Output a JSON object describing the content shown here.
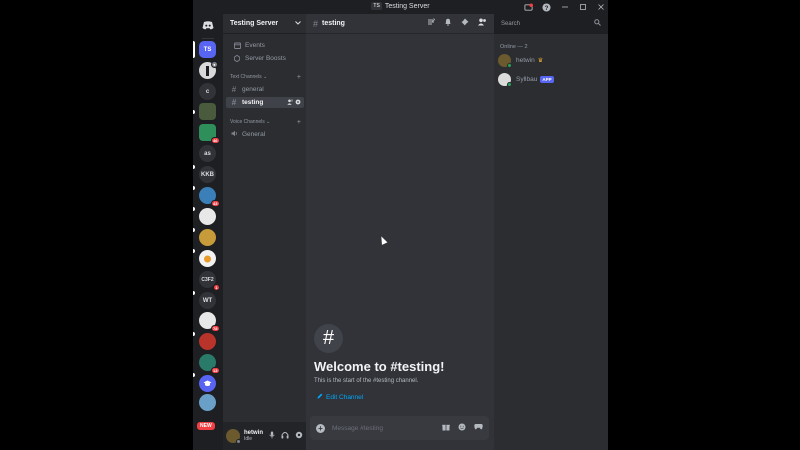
{
  "window": {
    "badge": "TS",
    "title": "Testing Server",
    "icons": [
      "inbox-icon",
      "help-icon",
      "minimize-icon",
      "maximize-icon",
      "close-icon"
    ]
  },
  "guild_list": {
    "items": [
      {
        "label": "TS",
        "selected": true
      },
      {
        "label": "",
        "badge": ""
      },
      {
        "label": "c"
      },
      {
        "label": ""
      },
      {
        "label": "",
        "badge": "46"
      },
      {
        "label": "as"
      },
      {
        "label": "KKB"
      },
      {
        "label": "",
        "badge": "43"
      },
      {
        "label": ""
      },
      {
        "label": ""
      },
      {
        "label": ""
      },
      {
        "label": "C3F2",
        "badge": "1"
      },
      {
        "label": "WT"
      },
      {
        "label": "",
        "badge": "78"
      },
      {
        "label": ""
      },
      {
        "label": "",
        "badge": "13"
      },
      {
        "label": ""
      },
      {
        "label": ""
      }
    ],
    "new_badge": "NEW"
  },
  "sidebar": {
    "server_name": "Testing Server",
    "top_items": [
      {
        "label": "Events",
        "icon": "calendar-icon"
      },
      {
        "label": "Server Boosts",
        "icon": "boost-icon"
      }
    ],
    "text_category": "Text Channels",
    "text_channels": [
      {
        "name": "general",
        "active": false
      },
      {
        "name": "testing",
        "active": true
      }
    ],
    "voice_category": "Voice Channels",
    "voice_channels": [
      {
        "name": "General"
      }
    ]
  },
  "user": {
    "name": "hetwin",
    "status": "Idle"
  },
  "channel": {
    "name": "testing",
    "welcome_title": "Welcome to #testing!",
    "welcome_sub": "This is the start of the #testing channel.",
    "edit_label": "Edit Channel",
    "message_placeholder": "Message #testing"
  },
  "search": {
    "placeholder": "Search"
  },
  "members": {
    "category": "Online — 2",
    "list": [
      {
        "name": "hetwin",
        "owner": true,
        "color": "#6b5a2e"
      },
      {
        "name": "Syllbau",
        "tag": "APP",
        "color": "#dcdcdc"
      }
    ]
  },
  "colors": {
    "accent": "#5865f2",
    "online": "#23a55a",
    "link": "#00a8fc",
    "danger": "#f23f43"
  }
}
